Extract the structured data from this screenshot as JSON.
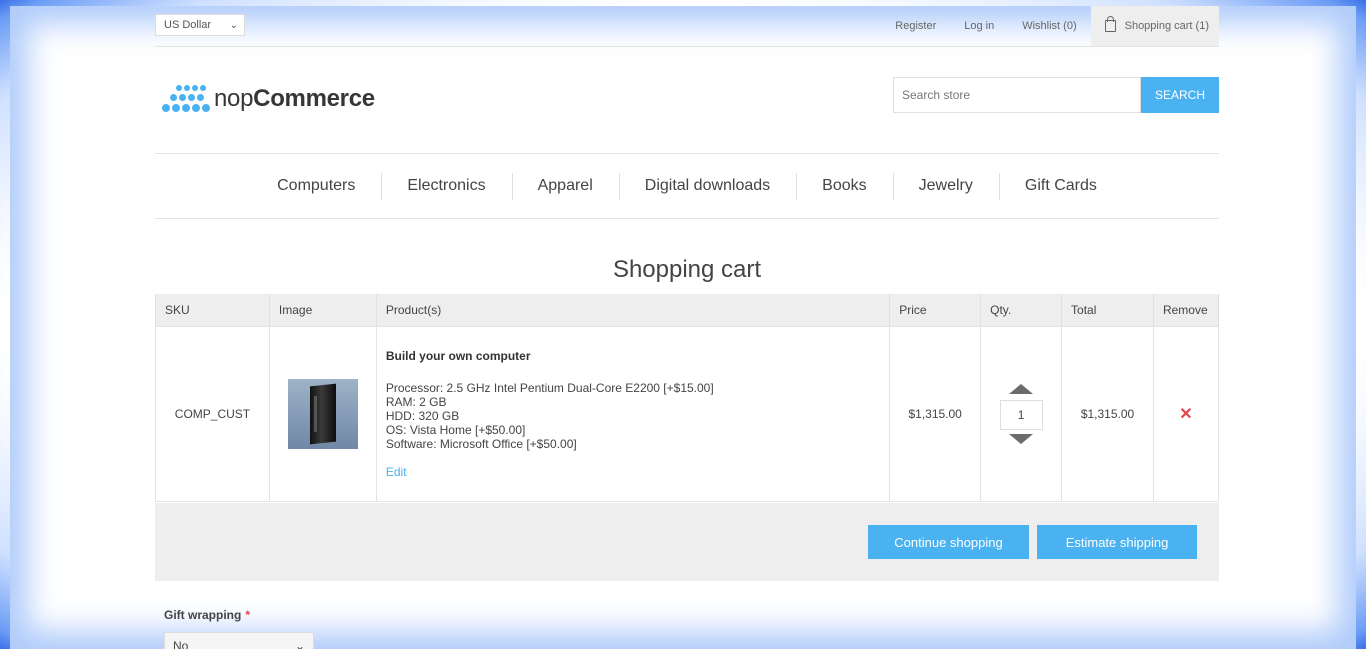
{
  "header": {
    "currency": "US Dollar",
    "links": {
      "register": "Register",
      "login": "Log in",
      "wishlist": "Wishlist (0)",
      "cart": "Shopping cart (1)"
    },
    "logo_light": "nop",
    "logo_bold": "Commerce",
    "search_placeholder": "Search store",
    "search_button": "SEARCH"
  },
  "menu": [
    "Computers",
    "Electronics",
    "Apparel",
    "Digital downloads",
    "Books",
    "Jewelry",
    "Gift Cards"
  ],
  "page_title": "Shopping cart",
  "table": {
    "headers": [
      "SKU",
      "Image",
      "Product(s)",
      "Price",
      "Qty.",
      "Total",
      "Remove"
    ],
    "rows": [
      {
        "sku": "COMP_CUST",
        "product_name": "Build your own computer",
        "attributes": "Processor: 2.5 GHz Intel Pentium Dual-Core E2200 [+$15.00]\nRAM: 2 GB\nHDD: 320 GB\nOS: Vista Home [+$50.00]\nSoftware: Microsoft Office [+$50.00]",
        "edit": "Edit",
        "price": "$1,315.00",
        "qty": "1",
        "total": "$1,315.00",
        "remove": "✕"
      }
    ]
  },
  "buttons": {
    "continue": "Continue shopping",
    "estimate": "Estimate shipping"
  },
  "gift_wrapping": {
    "label": "Gift wrapping",
    "required": "*",
    "value": "No"
  },
  "colors": {
    "accent": "#4ab2f1",
    "remove": "#e4434b"
  }
}
